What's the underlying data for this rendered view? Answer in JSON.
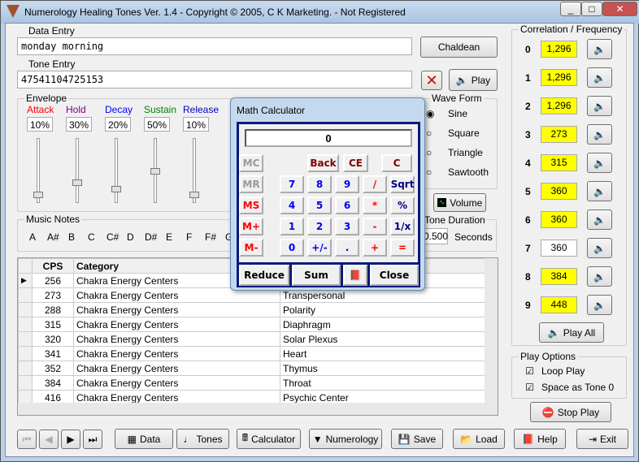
{
  "title": "Numerology Healing Tones Ver. 1.4 - Copyright © 2005, C K Marketing.  - Not Registered",
  "data_entry": {
    "label": "Data Entry",
    "value": "monday morning",
    "button": "Chaldean"
  },
  "tone_entry": {
    "label": "Tone Entry",
    "value": "47541104725153",
    "play": "Play"
  },
  "envelope": {
    "label": "Envelope",
    "params": [
      {
        "name": "Attack",
        "value": "10%",
        "color": "#ff0000",
        "level": 0.1
      },
      {
        "name": "Hold",
        "value": "30%",
        "color": "#800080",
        "level": 0.3
      },
      {
        "name": "Decay",
        "value": "20%",
        "color": "#0000ff",
        "level": 0.2
      },
      {
        "name": "Sustain",
        "value": "50%",
        "color": "#008000",
        "level": 0.5
      },
      {
        "name": "Release",
        "value": "10%",
        "color": "#0000c0",
        "level": 0.1
      }
    ]
  },
  "wave_form": {
    "label": "Wave Form",
    "options": [
      "Sine",
      "Square",
      "Triangle",
      "Sawtooth"
    ],
    "selected": "Sine"
  },
  "volume": "Volume",
  "music_notes": {
    "label": "Music Notes",
    "notes": [
      "A",
      "A#",
      "B",
      "C",
      "C#",
      "D",
      "D#",
      "E",
      "F",
      "F#",
      "G"
    ]
  },
  "duration": {
    "label": "Tone Duration",
    "value": "0.500",
    "unit": "Seconds"
  },
  "table": {
    "headers": [
      "CPS",
      "Category",
      ""
    ],
    "rows": [
      [
        "256",
        "Chakra Energy Centers",
        ""
      ],
      [
        "273",
        "Chakra Energy Centers",
        "Transpersonal"
      ],
      [
        "288",
        "Chakra Energy Centers",
        "Polarity"
      ],
      [
        "315",
        "Chakra Energy Centers",
        "Diaphragm"
      ],
      [
        "320",
        "Chakra Energy Centers",
        "Solar Plexus"
      ],
      [
        "341",
        "Chakra Energy Centers",
        "Heart"
      ],
      [
        "352",
        "Chakra Energy Centers",
        "Thymus"
      ],
      [
        "384",
        "Chakra Energy Centers",
        "Throat"
      ],
      [
        "416",
        "Chakra Energy Centers",
        "Psychic Center"
      ]
    ]
  },
  "correlation": {
    "label": "Correlation /  Frequency",
    "rows": [
      {
        "n": "0",
        "v": "1,296",
        "hl": true
      },
      {
        "n": "1",
        "v": "1,296",
        "hl": true
      },
      {
        "n": "2",
        "v": "1,296",
        "hl": true
      },
      {
        "n": "3",
        "v": "273",
        "hl": true
      },
      {
        "n": "4",
        "v": "315",
        "hl": true
      },
      {
        "n": "5",
        "v": "360",
        "hl": true
      },
      {
        "n": "6",
        "v": "360",
        "hl": true
      },
      {
        "n": "7",
        "v": "360",
        "hl": false
      },
      {
        "n": "8",
        "v": "384",
        "hl": true
      },
      {
        "n": "9",
        "v": "448",
        "hl": true
      }
    ],
    "play_all": "Play All"
  },
  "play_options": {
    "label": "Play Options",
    "loop": "Loop Play",
    "space": "Space as Tone 0",
    "loop_checked": true,
    "space_checked": true
  },
  "stop_play": "Stop Play",
  "toolbar": {
    "data": "Data",
    "tones": "Tones",
    "calculator": "Calculator",
    "numerology": "Numerology",
    "save": "Save",
    "load": "Load",
    "help": "Help",
    "exit": "Exit"
  },
  "calculator": {
    "title": "Math Calculator",
    "display": "0",
    "buttons": [
      [
        "MC",
        "",
        "Back",
        "CE",
        "C"
      ],
      [
        "MR",
        "7",
        "8",
        "9",
        "/",
        "Sqrt"
      ],
      [
        "MS",
        "4",
        "5",
        "6",
        "*",
        "%"
      ],
      [
        "M+",
        "1",
        "2",
        "3",
        "-",
        "1/x"
      ],
      [
        "M-",
        "0",
        "+/-",
        ".",
        "+",
        "="
      ]
    ],
    "reduce": "Reduce",
    "sum": "Sum",
    "close": "Close"
  }
}
